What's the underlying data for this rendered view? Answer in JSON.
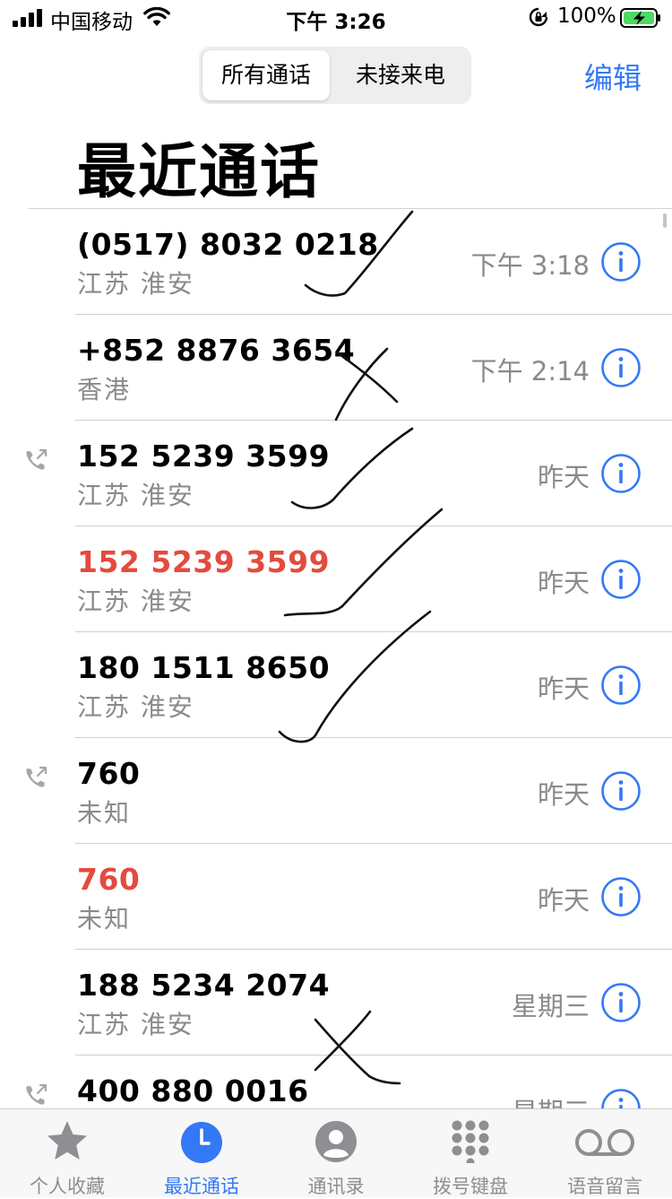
{
  "status_bar": {
    "carrier": "中国移动",
    "time": "下午 3:26",
    "battery": "100%"
  },
  "segmented": {
    "all_label": "所有通话",
    "missed_label": "未接来电"
  },
  "edit_label": "编辑",
  "title": "最近通话",
  "calls": [
    {
      "number": "(0517) 8032 0218",
      "location": "江苏 淮安",
      "time": "下午 3:18",
      "missed": false,
      "outgoing": false
    },
    {
      "number": "+852 8876 3654",
      "location": "香港",
      "time": "下午 2:14",
      "missed": false,
      "outgoing": false
    },
    {
      "number": "152 5239 3599",
      "location": "江苏 淮安",
      "time": "昨天",
      "missed": false,
      "outgoing": true
    },
    {
      "number": "152 5239 3599",
      "location": "江苏 淮安",
      "time": "昨天",
      "missed": true,
      "outgoing": false
    },
    {
      "number": "180 1511 8650",
      "location": "江苏 淮安",
      "time": "昨天",
      "missed": false,
      "outgoing": false
    },
    {
      "number": "760",
      "location": "未知",
      "time": "昨天",
      "missed": false,
      "outgoing": true
    },
    {
      "number": "760",
      "location": "未知",
      "time": "昨天",
      "missed": true,
      "outgoing": false
    },
    {
      "number": "188 5234 2074",
      "location": "江苏 淮安",
      "time": "星期三",
      "missed": false,
      "outgoing": false
    },
    {
      "number": "400 880 0016",
      "location": "",
      "time": "星期三",
      "missed": false,
      "outgoing": true
    }
  ],
  "tabs": [
    {
      "label": "个人收藏",
      "icon": "star-icon",
      "active": false
    },
    {
      "label": "最近通话",
      "icon": "clock-icon",
      "active": true
    },
    {
      "label": "通讯录",
      "icon": "contacts-icon",
      "active": false
    },
    {
      "label": "拨号键盘",
      "icon": "keypad-icon",
      "active": false
    },
    {
      "label": "语音留言",
      "icon": "voicemail-icon",
      "active": false
    }
  ],
  "colors": {
    "accent": "#3478f6",
    "missed": "#e34b3e",
    "secondary_text": "#8a8a8e"
  }
}
